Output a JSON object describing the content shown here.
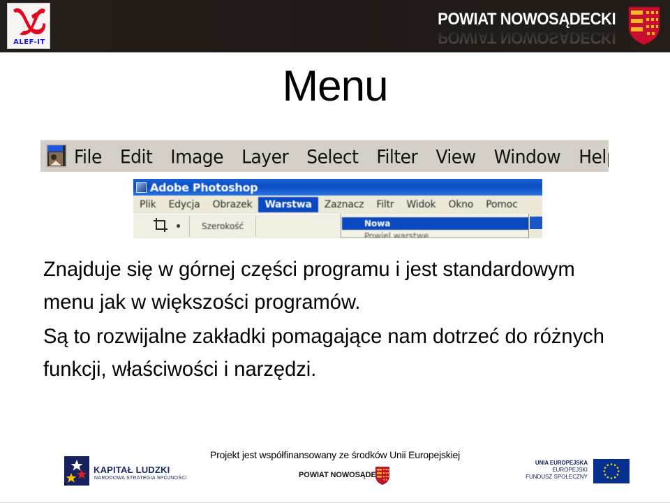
{
  "header": {
    "left_logo": {
      "name": "ALEF-IT",
      "mark": "aleph-letter",
      "mark_color": "#e2071e",
      "text_color": "#1713e0"
    },
    "brand_title": "POWIAT NOWOSĄDECKI",
    "brand_reflection": "POWIAT NOWOSĄDECKI",
    "shield_alt": "powiat-nowosadecki-coat-of-arms",
    "background_color": "#211b18",
    "shield_red": "#c8102e",
    "shield_gold": "#f5b921"
  },
  "slide": {
    "title": "Menu"
  },
  "photoshop_en": {
    "icon_alt": "adobe-photoshop-icon",
    "menu_items": [
      "File",
      "Edit",
      "Image",
      "Layer",
      "Select",
      "Filter",
      "View",
      "Window",
      "Help"
    ],
    "background_color": "#d4d0c8"
  },
  "photoshop_pl": {
    "window_title": "Adobe Photoshop",
    "menu_items": [
      "Plik",
      "Edycja",
      "Obrazek",
      "Warstwa",
      "Zaznacz",
      "Filtr",
      "Widok",
      "Okno",
      "Pomoc"
    ],
    "selected_menu": "Warstwa",
    "tool_label": "Szerokość",
    "dropdown": {
      "selected_item": "Nowa",
      "second_item": "Powiel warstwę",
      "submenu_arrow": "chevron-right-icon"
    },
    "highlight_color": "#0a49c0",
    "menubar_color": "#ece9d8"
  },
  "body": {
    "paragraphs": [
      "Znajduje się w górnej części programu i jest standardowym menu jak w większości programów.",
      "Są to rozwijalne zakładki pomagające nam dotrzeć do różnych funkcji, właściwości i narzędzi."
    ],
    "paragraph_1": "Znajduje się w górnej części programu i jest standardowym menu jak w większości programów.",
    "paragraph_2": "Są to rozwijalne zakładki pomagające nam dotrzeć do różnych funkcji, właściwości i narzędzi."
  },
  "footer": {
    "center_text": "Projekt jest  współfinansowany ze środków Unii Europejskiej",
    "kapital_ludzki": {
      "line1": "KAPITAŁ LUDZKI",
      "line2": "NARODOWA STRATEGIA SPÓJNOŚCI",
      "color": "#1b2b6b"
    },
    "powiat": {
      "label": "POWIAT NOWOSĄDECKI",
      "shield_alt": "powiat-nowosadecki-coat-of-arms"
    },
    "unia": {
      "line1": "UNIA EUROPEJSKA",
      "line2": "EUROPEJSKI",
      "line3": "FUNDUSZ SPOŁECZNY",
      "flag_alt": "european-union-flag",
      "flag_color": "#05308f",
      "star_color": "#f5d200"
    }
  }
}
